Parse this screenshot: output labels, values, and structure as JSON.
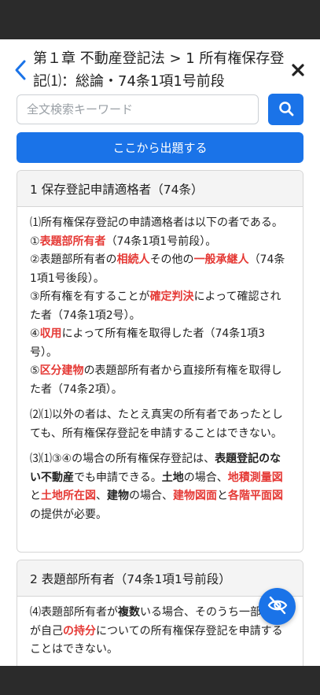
{
  "header": {
    "title": "第１章 不動産登記法 > 1 所有権保存登記⑴：総論・74条1項1号前段"
  },
  "search": {
    "placeholder": "全文検索キーワード"
  },
  "actions": {
    "start_label": "ここから出題する"
  },
  "section1": {
    "title": "1 保存登記申請適格者（74条）",
    "p1_intro": "⑴所有権保存登記の申請適格者は以下の者である。",
    "i1_num": "①",
    "i1_red": "表題部所有者",
    "i1_rest": "（74条1項1号前段）。",
    "i2_a": "②表題部所有者の",
    "i2_red1": "相続人",
    "i2_b": "その他の",
    "i2_red2": "一般承継人",
    "i2_c": "（74条1項1号後段）。",
    "i3_a": "③所有権を有することが",
    "i3_red": "確定判決",
    "i3_b": "によって確認された者（74条1項2号）。",
    "i4_num": "④",
    "i4_red": "収用",
    "i4_rest": "によって所有権を取得した者（74条1項3号）。",
    "i5_num": "⑤",
    "i5_red": "区分建物",
    "i5_rest": "の表題部所有者から直接所有権を取得した者（74条2項）。",
    "p2": "⑵⑴以外の者は、たとえ真実の所有者であったとしても、所有権保存登記を申請することはできない。",
    "p3_a": "⑶⑴③④の場合の所有権保存登記は、",
    "p3_b1": "表題登記のない不動産",
    "p3_c": "でも申請できる。",
    "p3_b2": "土地",
    "p3_d": "の場合、",
    "p3_r1": "地積測量図",
    "p3_e": "と",
    "p3_r2": "土地所在図",
    "p3_f": "、",
    "p3_b3": "建物",
    "p3_g": "の場合、",
    "p3_r3": "建物図面",
    "p3_h": "と",
    "p3_r4": "各階平面図",
    "p3_i": "の提供が必要。"
  },
  "section2": {
    "title": "2 表題部所有者（74条1項1号前段）",
    "p4_a": "⑷表題部所有者が",
    "p4_b": "複数",
    "p4_c": "いる場合、そのうち一部の者が自己",
    "p4_r": "の持分",
    "p4_d": "についての所有権保存登記を申請することはできない。"
  },
  "icons": {
    "accent": "#1a73e8",
    "highlight": "#e53935",
    "back": "chevron-left-icon",
    "close": "close-icon",
    "search": "search-icon",
    "fab": "eye-off-icon"
  }
}
